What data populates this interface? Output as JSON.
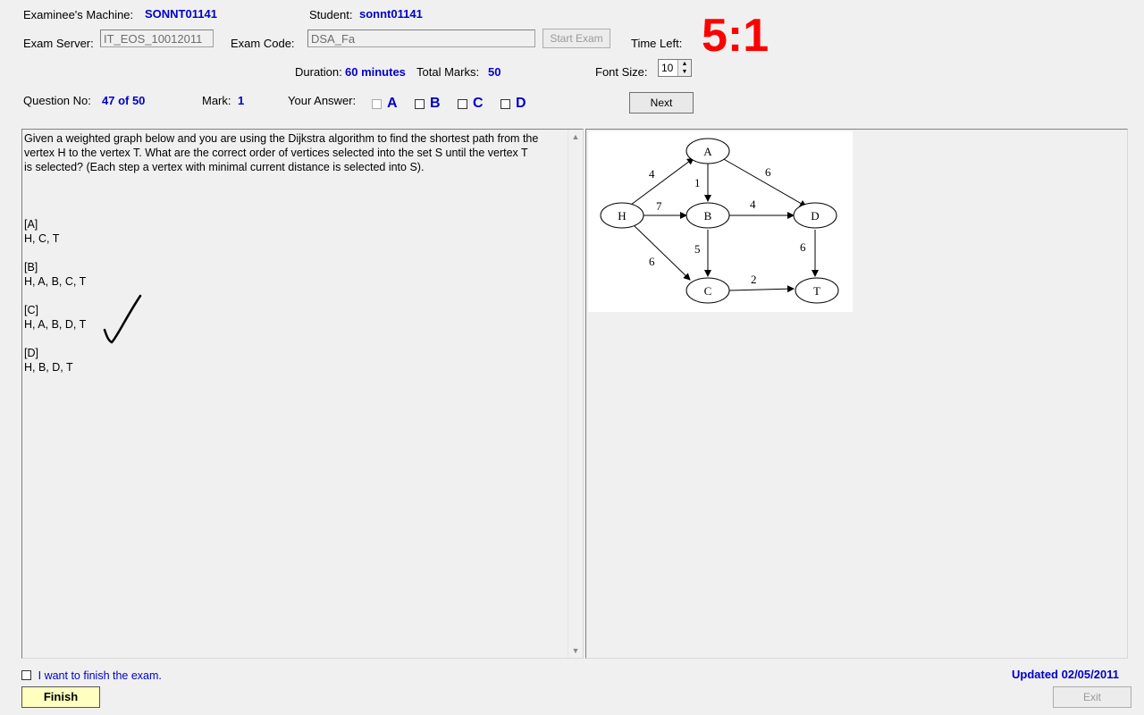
{
  "header": {
    "machine_label": "Examinee's Machine:",
    "machine_value": "SONNT01141",
    "student_label": "Student:",
    "student_value": "sonnt01141",
    "server_label": "Exam Server:",
    "server_value": "IT_EOS_10012011",
    "code_label": "Exam Code:",
    "code_value": "DSA_Fa",
    "start_button": "Start Exam",
    "time_left_label": "Time Left:",
    "time_left_value": "5:1",
    "duration_label": "Duration:",
    "duration_value": "60 minutes",
    "total_marks_label": "Total Marks:",
    "total_marks_value": "50",
    "font_size_label": "Font Size:",
    "font_size_value": "10"
  },
  "question_bar": {
    "question_no_label": "Question No:",
    "question_no_value": "47 of 50",
    "mark_label": "Mark:",
    "mark_value": "1",
    "your_answer_label": "Your Answer:",
    "answers": [
      "A",
      "B",
      "C",
      "D"
    ],
    "next_button": "Next"
  },
  "question": {
    "line1": "Given a weighted graph below and you are using the Dijkstra algorithm to find the shortest path from the",
    "line2": "vertex  H  to the vertex  T. What are the correct order of vertices selected into the set  S until the vertex  T",
    "line3": " is selected? (Each step a vertex with minimal current distance is selected into S).",
    "options": [
      {
        "key": "[A]",
        "text": "H, C, T"
      },
      {
        "key": "[B]",
        "text": "H, A, B, C, T"
      },
      {
        "key": "[C]",
        "text": "H, A, B, D, T"
      },
      {
        "key": "[D]",
        "text": "H, B, D, T"
      }
    ]
  },
  "graph": {
    "nodes": [
      "H",
      "A",
      "B",
      "C",
      "D",
      "T"
    ],
    "edges": [
      {
        "from": "H",
        "to": "A",
        "weight": "4"
      },
      {
        "from": "H",
        "to": "B",
        "weight": "7"
      },
      {
        "from": "H",
        "to": "C",
        "weight": "6"
      },
      {
        "from": "A",
        "to": "B",
        "weight": "1"
      },
      {
        "from": "A",
        "to": "D",
        "weight": "6"
      },
      {
        "from": "B",
        "to": "D",
        "weight": "4"
      },
      {
        "from": "B",
        "to": "C",
        "weight": "5"
      },
      {
        "from": "D",
        "to": "T",
        "weight": "6"
      },
      {
        "from": "C",
        "to": "T",
        "weight": "2"
      }
    ]
  },
  "footer": {
    "finish_checkbox_label": "I want to finish the exam.",
    "finish_button": "Finish",
    "updated": "Updated 02/05/2011",
    "exit_button": "Exit"
  },
  "colors": {
    "accent_blue": "#0000cc",
    "timer_red": "#ff0000",
    "finish_button_bg": "#ffffc0"
  }
}
